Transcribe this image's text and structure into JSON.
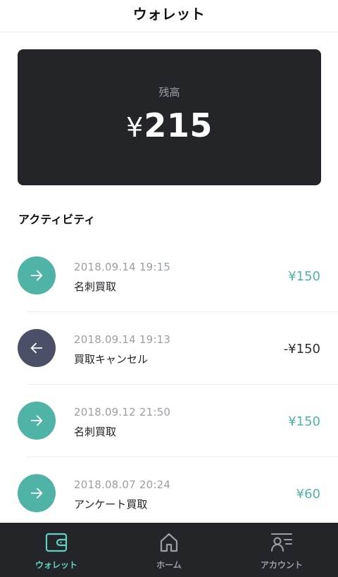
{
  "header": {
    "title": "ウォレット"
  },
  "balance": {
    "label": "残高",
    "currency": "¥",
    "amount": "215"
  },
  "activity": {
    "title": "アクティビティ",
    "items": [
      {
        "datetime": "2018.09.14 19:15",
        "description": "名刺買取",
        "amount": "¥150",
        "direction": "in"
      },
      {
        "datetime": "2018.09.14 19:13",
        "description": "買取キャンセル",
        "amount": "-¥150",
        "direction": "out"
      },
      {
        "datetime": "2018.09.12 21:50",
        "description": "名刺買取",
        "amount": "¥150",
        "direction": "in"
      },
      {
        "datetime": "2018.08.07 20:24",
        "description": "アンケート買取",
        "amount": "¥60",
        "direction": "in"
      }
    ]
  },
  "tabbar": {
    "tabs": [
      {
        "label": "ウォレット",
        "icon": "wallet-icon",
        "active": true
      },
      {
        "label": "ホーム",
        "icon": "home-icon",
        "active": false
      },
      {
        "label": "アカウント",
        "icon": "account-icon",
        "active": false
      }
    ]
  },
  "colors": {
    "accent": "#5fd3c1",
    "incoming": "#4fb3a5",
    "outgoing": "#4b5068",
    "card": "#232529"
  }
}
